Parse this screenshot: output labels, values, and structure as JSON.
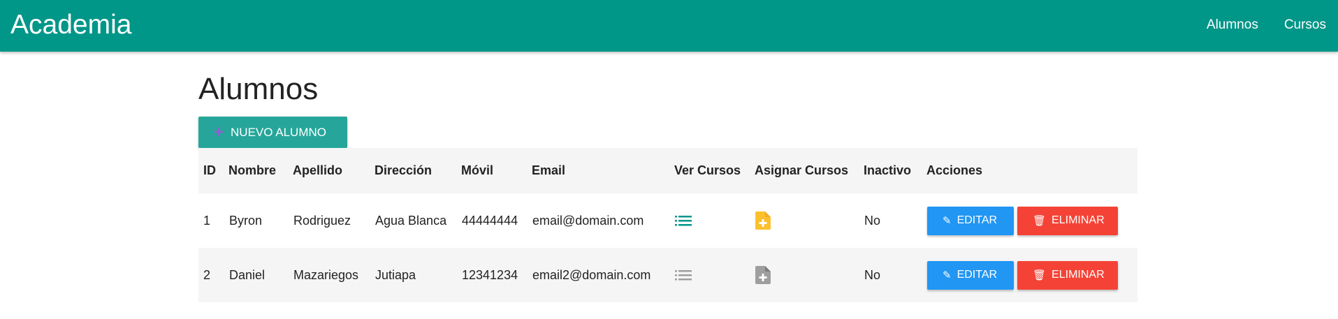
{
  "navbar": {
    "brand": "Academia",
    "links": [
      "Alumnos",
      "Cursos"
    ]
  },
  "page": {
    "title": "Alumnos",
    "new_button_label": "NUEVO ALUMNO"
  },
  "table": {
    "headers": [
      "ID",
      "Nombre",
      "Apellido",
      "Dirección",
      "Móvil",
      "Email",
      "Ver Cursos",
      "Asignar Cursos",
      "Inactivo",
      "Acciones"
    ],
    "rows": [
      {
        "id": "1",
        "nombre": "Byron",
        "apellido": "Rodriguez",
        "direccion": "Agua Blanca",
        "movil": "44444444",
        "email": "email@domain.com",
        "inactivo": "No",
        "list_icon": "list-icon",
        "file_icon": "file-add-icon",
        "icon_color_list": "#009688",
        "icon_color_file": "#fbc02d"
      },
      {
        "id": "2",
        "nombre": "Daniel",
        "apellido": "Mazariegos",
        "direccion": "Jutiapa",
        "movil": "12341234",
        "email": "email2@domain.com",
        "inactivo": "No",
        "list_icon": "list-icon",
        "file_icon": "file-add-icon",
        "icon_color_list": "#9e9e9e",
        "icon_color_file": "#9e9e9e"
      }
    ],
    "edit_label": "EDITAR",
    "delete_label": "ELIMINAR"
  },
  "colors": {
    "primary": "#009688",
    "button_new": "#26a69a",
    "button_edit": "#2196f3",
    "button_delete": "#f44336"
  }
}
